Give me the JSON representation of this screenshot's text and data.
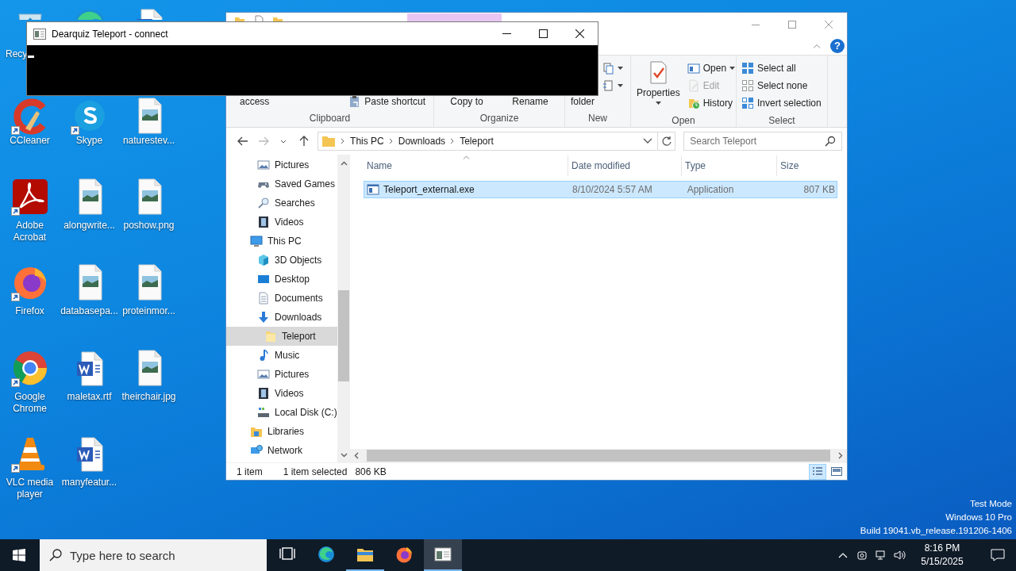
{
  "desktop": {
    "icons": [
      {
        "label": "Recy",
        "kind": "recycle-bin",
        "shortcut": false
      },
      {
        "kind": "edge",
        "shortcut": false
      },
      {
        "kind": "word-doc",
        "shortcut": false
      },
      {
        "label": "CCleaner",
        "kind": "ccleaner",
        "shortcut": true
      },
      {
        "label": "Skype",
        "kind": "skype",
        "shortcut": true
      },
      {
        "label": "naturestev...",
        "kind": "image-file",
        "shortcut": false
      },
      {
        "label": "Adobe Acrobat",
        "kind": "acrobat",
        "shortcut": true
      },
      {
        "label": "alongwrite...",
        "kind": "image-file",
        "shortcut": false
      },
      {
        "label": "poshow.png",
        "kind": "image-file",
        "shortcut": false
      },
      {
        "label": "Firefox",
        "kind": "firefox",
        "shortcut": true
      },
      {
        "label": "databasepa...",
        "kind": "image-file",
        "shortcut": false
      },
      {
        "label": "proteinmor...",
        "kind": "image-file",
        "shortcut": false
      },
      {
        "label": "Google Chrome",
        "kind": "chrome",
        "shortcut": true
      },
      {
        "label": "maletax.rtf",
        "kind": "word-doc",
        "shortcut": false
      },
      {
        "label": "theirchair.jpg",
        "kind": "image-file",
        "shortcut": false
      },
      {
        "label": "VLC media player",
        "kind": "vlc",
        "shortcut": true
      },
      {
        "label": "manyfeatur...",
        "kind": "word-doc",
        "shortcut": false
      }
    ]
  },
  "explorer": {
    "help_button": "?",
    "ribbon": {
      "groups": [
        {
          "label": "Clipboard",
          "columns": [
            [
              {
                "label": "access",
                "kind": "large-wrapped",
                "dropdown": false,
                "disabled": false
              }
            ],
            [
              {
                "label": "Paste shortcut",
                "kind": "small",
                "dropdown": false,
                "disabled": false
              }
            ]
          ]
        },
        {
          "label": "Organize",
          "columns": [
            [
              {
                "label": "Copy to",
                "kind": "large-wrapped",
                "dropdown": false,
                "disabled": false
              }
            ],
            [
              {
                "label": "Rename",
                "kind": "large-wrapped",
                "dropdown": false,
                "disabled": false
              }
            ]
          ]
        },
        {
          "label": "New",
          "columns": [
            [
              {
                "label": "folder",
                "kind": "large-wrapped",
                "dropdown": false,
                "disabled": false
              }
            ],
            [
              {
                "kind": "small",
                "dropdown": true,
                "disabled": false
              },
              {
                "kind": "small",
                "dropdown": true,
                "disabled": false
              }
            ]
          ]
        },
        {
          "label": "Open",
          "columns": [
            [
              {
                "label": "Properties",
                "kind": "large",
                "dropdown": true,
                "disabled": false
              }
            ],
            [
              {
                "label": "Open",
                "kind": "small",
                "dropdown": true,
                "disabled": false
              },
              {
                "label": "Edit",
                "kind": "small",
                "dropdown": false,
                "disabled": true
              },
              {
                "label": "History",
                "kind": "small",
                "dropdown": false,
                "disabled": false
              }
            ]
          ]
        },
        {
          "label": "Select",
          "columns": [
            [
              {
                "label": "Select all",
                "kind": "small",
                "dropdown": false,
                "disabled": false
              },
              {
                "label": "Select none",
                "kind": "small",
                "dropdown": false,
                "disabled": false
              },
              {
                "label": "Invert selection",
                "kind": "small",
                "dropdown": false,
                "disabled": false
              }
            ]
          ]
        }
      ]
    },
    "address_bar": {
      "breadcrumbs": [
        "This PC",
        "Downloads",
        "Teleport"
      ]
    },
    "search": {
      "placeholder": "Search Teleport"
    },
    "nav_pane": {
      "items": [
        {
          "children": [
            {
              "label": "Pictures",
              "kind": "pictures",
              "selected": false
            },
            {
              "label": "Saved Games",
              "kind": "saved-games",
              "selected": false
            },
            {
              "label": "Searches",
              "kind": "searches",
              "selected": false
            },
            {
              "label": "Videos",
              "kind": "videos",
              "selected": false
            }
          ]
        },
        {
          "label": "This PC",
          "kind": "this-pc",
          "selected": false,
          "children": [
            {
              "label": "3D Objects",
              "kind": "objects",
              "selected": false
            },
            {
              "label": "Desktop",
              "kind": "desktop",
              "selected": false
            },
            {
              "label": "Documents",
              "kind": "documents",
              "selected": false
            },
            {
              "label": "Downloads",
              "kind": "downloads",
              "selected": false,
              "children": [
                {
                  "label": "Teleport",
                  "kind": "folder",
                  "selected": true
                }
              ]
            },
            {
              "label": "Music",
              "kind": "music",
              "selected": false
            },
            {
              "label": "Pictures",
              "kind": "pictures",
              "selected": false
            },
            {
              "label": "Videos",
              "kind": "videos",
              "selected": false
            },
            {
              "label": "Local Disk (C:)",
              "kind": "local-disk",
              "selected": false
            }
          ]
        },
        {
          "label": "Libraries",
          "kind": "libraries",
          "selected": false
        },
        {
          "label": "Network",
          "kind": "network",
          "selected": false
        }
      ]
    },
    "file_list": {
      "columns": [
        {
          "label": "Name",
          "sorted": true
        },
        {
          "label": "Date modified",
          "sorted": false
        },
        {
          "label": "Type",
          "sorted": false
        },
        {
          "label": "Size",
          "sorted": false
        }
      ],
      "rows": [
        {
          "cells": [
            "Teleport_external.exe",
            "8/10/2024 5:57 AM",
            "Application",
            "807 KB"
          ],
          "selected": true
        }
      ]
    },
    "status_bar": {
      "item_count": "1 item",
      "selection": "1 item selected",
      "selection_size": "806 KB",
      "views": [
        {
          "kind": "details",
          "selected": true
        },
        {
          "kind": "large-icons",
          "selected": false
        }
      ]
    }
  },
  "console": {
    "title": "Dearquiz Teleport - connect",
    "cursor_visible": true
  },
  "windows_watermark": [
    "Test Mode",
    "Windows 10 Pro",
    "Build 19041.vb_release.191206-1406"
  ],
  "taskbar": {
    "search": {
      "placeholder": "Type here to search"
    },
    "apps": [
      {
        "kind": "task-view",
        "running": false,
        "active": false
      },
      {
        "kind": "edge",
        "running": false,
        "active": false
      },
      {
        "kind": "file-explorer",
        "running": true,
        "active": false
      },
      {
        "kind": "firefox",
        "running": false,
        "active": false
      },
      {
        "kind": "console",
        "running": true,
        "active": true
      }
    ],
    "clock": {
      "time": "8:16 PM",
      "date": "5/15/2025"
    }
  }
}
